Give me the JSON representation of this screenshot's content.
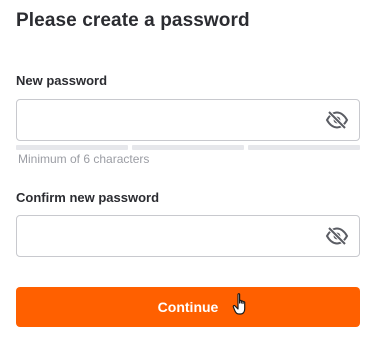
{
  "form": {
    "title": "Please create a password",
    "new_password": {
      "label": "New password",
      "value": "",
      "placeholder": "",
      "hint": "Minimum of 6 characters",
      "strength_segments": 3,
      "strength_filled": 0
    },
    "confirm_password": {
      "label": "Confirm new password",
      "value": "",
      "placeholder": ""
    },
    "continue_label": "Continue"
  },
  "icons": {
    "visibility_toggle": "eye-slash-icon",
    "cursor": "hand-pointer-icon"
  },
  "colors": {
    "accent": "#ff6000",
    "text": "#2b2c31",
    "hint": "#9b9da4",
    "border": "#c8c9ce",
    "strength_empty": "#e6e7eb"
  }
}
